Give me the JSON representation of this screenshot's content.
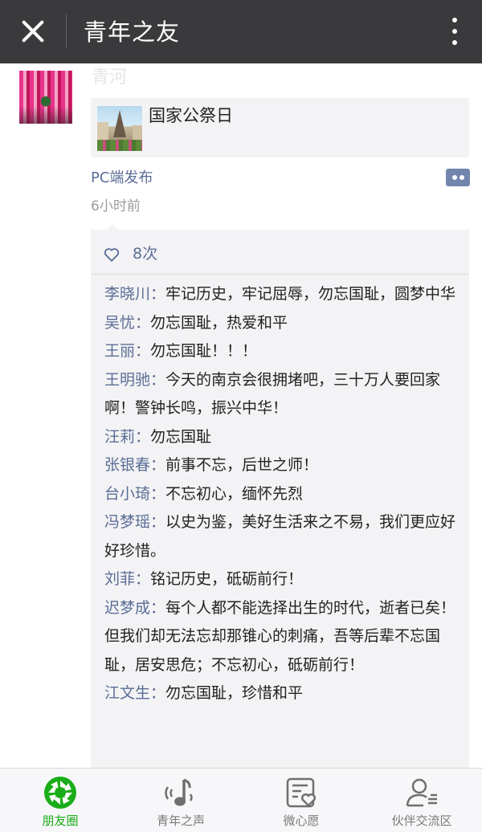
{
  "header": {
    "title": "青年之友",
    "close_icon": "close-icon",
    "more_icon": "more-vertical-icon"
  },
  "post": {
    "author": "青河",
    "link_title": "国家公祭日",
    "source": "PC端发布",
    "time": "6小时前",
    "likes": "8次",
    "comments": [
      {
        "name": "李晓川",
        "text": "牢记历史，牢记屈辱，勿忘国耻，圆梦中华"
      },
      {
        "name": "吴忧",
        "text": "勿忘国耻，热爱和平"
      },
      {
        "name": "王丽",
        "text": "勿忘国耻！！！"
      },
      {
        "name": "王明驰",
        "text": "今天的南京会很拥堵吧，三十万人要回家啊！警钟长鸣，振兴中华！"
      },
      {
        "name": "汪莉",
        "text": "勿忘国耻"
      },
      {
        "name": "张银春",
        "text": "前事不忘，后世之师！"
      },
      {
        "name": "台小琦",
        "text": "不忘初心，缅怀先烈"
      },
      {
        "name": "冯梦瑶",
        "text": "以史为鉴，美好生活来之不易，我们更应好好珍惜。"
      },
      {
        "name": "刘菲",
        "text": "铭记历史，砥砺前行！"
      },
      {
        "name": "迟梦成",
        "text": "每个人都不能选择出生的时代，逝者已矣！但我们却无法忘却那锥心的刺痛，吾等后辈不忘国耻，居安思危；不忘初心，砥砺前行！"
      },
      {
        "name": "江文生",
        "text": "勿忘国耻，珍惜和平"
      }
    ]
  },
  "tabs": [
    {
      "label": "朋友圈",
      "icon": "moments-camera-icon",
      "active": true
    },
    {
      "label": "青年之声",
      "icon": "music-note-icon",
      "active": false
    },
    {
      "label": "微心愿",
      "icon": "wish-card-icon",
      "active": false
    },
    {
      "label": "伙伴交流区",
      "icon": "partner-exchange-icon",
      "active": false
    }
  ],
  "colors": {
    "topbar": "#3a3a3c",
    "link_blue": "#5b6d96",
    "active_green": "#1aad19",
    "panel_gray": "#f3f3f5"
  }
}
